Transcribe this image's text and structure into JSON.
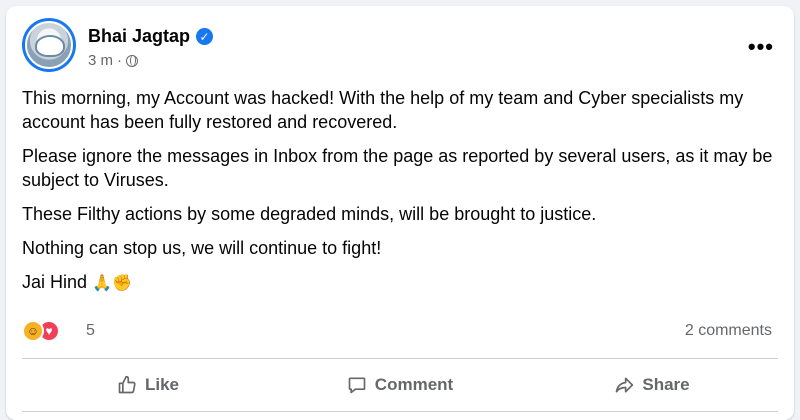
{
  "post": {
    "author": "Bhai Jagtap",
    "verified": true,
    "timestamp": "3 m",
    "meta_separator": "·",
    "audience_icon": "globe-icon",
    "more_label": "•••",
    "paragraphs": [
      "This morning, my Account was hacked! With the help of my team and Cyber specialists my account has been fully restored and recovered.",
      "Please ignore the messages in Inbox from the page as reported by several users, as it may be subject to Viruses.",
      "These Filthy actions by some degraded minds, will be brought to justice.",
      "Nothing can stop us, we will continue to fight!"
    ],
    "closing": "Jai Hind",
    "closing_emojis": [
      "🙏",
      "✊"
    ]
  },
  "reactions": {
    "icons": [
      "haha-icon",
      "love-icon"
    ],
    "count": "5",
    "comments": "2 comments"
  },
  "actions": {
    "like": "Like",
    "comment": "Comment",
    "share": "Share"
  },
  "colors": {
    "brand_blue": "#1877f2",
    "secondary_text": "#65676b",
    "love_red": "#f33e58",
    "haha_yellow": "#f7b125"
  }
}
